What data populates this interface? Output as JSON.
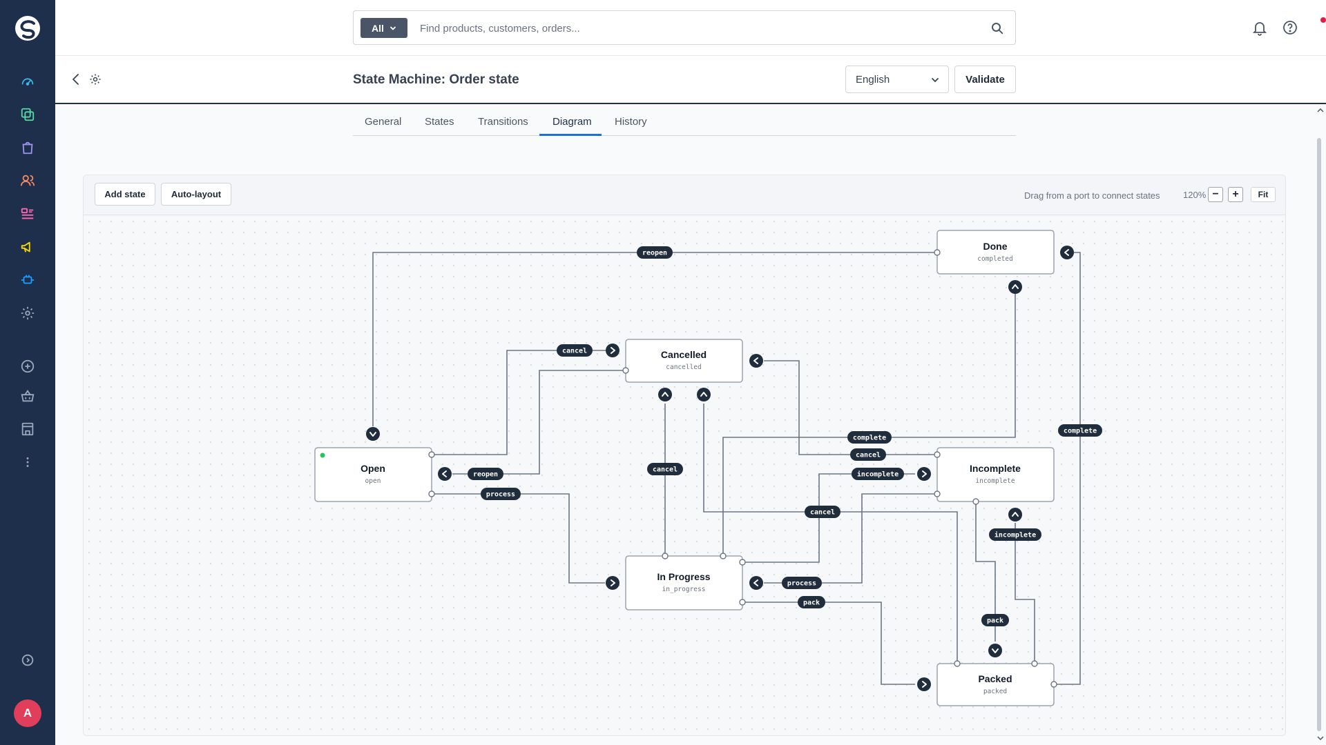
{
  "search": {
    "scope": "All",
    "placeholder": "Find products, customers, orders..."
  },
  "header": {
    "title": "State Machine: Order state",
    "language": "English",
    "validate_label": "Validate"
  },
  "tabs": [
    {
      "label": "General"
    },
    {
      "label": "States"
    },
    {
      "label": "Transitions"
    },
    {
      "label": "Diagram",
      "active": true
    },
    {
      "label": "History"
    }
  ],
  "toolbar": {
    "add_state": "Add state",
    "auto_layout": "Auto-layout",
    "hint": "Drag from a port to connect states",
    "zoom": "120%",
    "fit": "Fit"
  },
  "user": {
    "initial": "A"
  },
  "colors": {
    "sidebar": "#1d2f4a",
    "accent": "#1e73c9",
    "pill": "#1f2d3d",
    "initial_state": "#22c55e",
    "notification": "#e11d48",
    "avatar": "#e03e5a"
  },
  "sidebar_icons": [
    "dashboard-icon",
    "catalogues-icon",
    "orders-icon",
    "customers-icon",
    "content-icon",
    "marketing-icon",
    "extensions-icon",
    "settings-icon",
    "add-icon",
    "sales-channel-basket-icon",
    "sales-channel-storefront-icon",
    "more-icon",
    "collapse-icon"
  ],
  "diagram": {
    "states": [
      {
        "id": "done",
        "name": "Done",
        "technical_name": "completed"
      },
      {
        "id": "cancelled",
        "name": "Cancelled",
        "technical_name": "cancelled"
      },
      {
        "id": "open",
        "name": "Open",
        "technical_name": "open",
        "initial": true
      },
      {
        "id": "incomplete",
        "name": "Incomplete",
        "technical_name": "incomplete"
      },
      {
        "id": "in_progress",
        "name": "In Progress",
        "technical_name": "in_progress"
      },
      {
        "id": "packed",
        "name": "Packed",
        "technical_name": "packed"
      }
    ],
    "transitions": [
      {
        "id": "t1",
        "label": "reopen",
        "from": "done",
        "to": "open"
      },
      {
        "id": "t2",
        "label": "cancel",
        "from": "open",
        "to": "cancelled"
      },
      {
        "id": "t3",
        "label": "reopen",
        "from": "cancelled",
        "to": "open"
      },
      {
        "id": "t4",
        "label": "process",
        "from": "open",
        "to": "in_progress"
      },
      {
        "id": "t5",
        "label": "cancel",
        "from": "in_progress",
        "to": "cancelled"
      },
      {
        "id": "t6",
        "label": "complete",
        "from": "in_progress",
        "to": "done"
      },
      {
        "id": "t7",
        "label": "cancel",
        "from": "incomplete",
        "to": "cancelled"
      },
      {
        "id": "t8",
        "label": "incomplete",
        "from": "in_progress",
        "to": "incomplete"
      },
      {
        "id": "t9",
        "label": "cancel",
        "from": "packed",
        "to": "cancelled"
      },
      {
        "id": "t10",
        "label": "process",
        "from": "incomplete",
        "to": "in_progress"
      },
      {
        "id": "t11",
        "label": "incomplete",
        "from": "packed",
        "to": "incomplete"
      },
      {
        "id": "t12",
        "label": "complete",
        "from": "packed",
        "to": "done"
      },
      {
        "id": "t13",
        "label": "pack",
        "from": "in_progress",
        "to": "packed"
      },
      {
        "id": "t14",
        "label": "pack",
        "from": "incomplete",
        "to": "packed"
      }
    ]
  }
}
